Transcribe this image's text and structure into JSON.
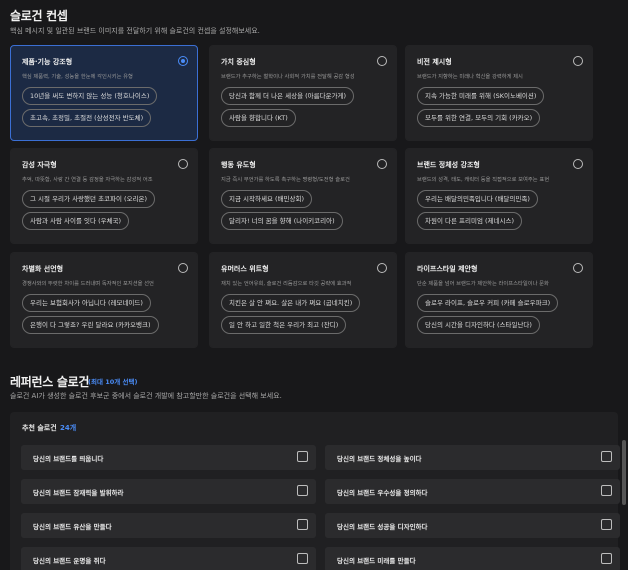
{
  "header": {
    "title": "슬로건 컨셉",
    "description": "핵심 메시지 및 일관된 브랜드 이미지를 전달하기 위해 슬로건의 컨셉을 설정해보세요."
  },
  "concepts": [
    {
      "title": "제품·기능 강조형",
      "desc": "핵심 제품력, 기술, 성능을 한눈에 각인시키는 유형",
      "selected": true,
      "examples": [
        "10년을 써도 변하지 않는 성능 (청호나이스)",
        "초고속, 초정밀, 초절전 (삼성전자 반도체)"
      ]
    },
    {
      "title": "가치 중심형",
      "desc": "브랜드가 추구하는 철학이나 사회적 가치를 전달해 공감 형성",
      "selected": false,
      "examples": [
        "당신과 함께 더 나은 세상을 (아름다운가게)",
        "사람을 향합니다 (KT)"
      ]
    },
    {
      "title": "비전 제시형",
      "desc": "브랜드가 지향하는 미래나 혁신을 강력하게 제시",
      "selected": false,
      "examples": [
        "지속 가능한 미래를 위해 (SK이노베이션)",
        "모두를 위한 연결, 모두의 기회 (카카오)"
      ]
    },
    {
      "title": "감성 자극형",
      "desc": "추억, 따뜻함, 사랑 간 연결 등 감정을 자극하는 감성적 어조",
      "selected": false,
      "examples": [
        "그 시절 우리가 사랑했던 초코파이 (오리온)",
        "사람과 사람 사이를 잇다 (우체국)"
      ]
    },
    {
      "title": "행동 유도형",
      "desc": "지금 즉시 무언가를 하도록 촉구하는 명령형/도전형 슬로건",
      "selected": false,
      "examples": [
        "지금 시작하세요 (배민상회)",
        "달리자! 너의 꿈을 향해 (나이키코리아)"
      ]
    },
    {
      "title": "브랜드 정체성 강조형",
      "desc": "브랜드의 성격, 태도, 캐릭터 등을 직접적으로 보여주는 표현",
      "selected": false,
      "examples": [
        "우리는 배달의민족입니다 (배달의민족)",
        "차원이 다른 프리미엄 (제네시스)"
      ]
    },
    {
      "title": "차별화 선언형",
      "desc": "경쟁사와의 뚜렷한 차이를 드러내며 독자적인 포지션을 선언",
      "selected": false,
      "examples": [
        "우리는 보험회사가 아닙니다 (레모네이드)",
        "은행이 다 그렇죠? 우린 달라요 (카카오뱅크)"
      ]
    },
    {
      "title": "유머러스 위트형",
      "desc": "재치 있는 언어유희, 슬로건 리듬감으로 타깃 공략에 효과적",
      "selected": false,
      "examples": [
        "치킨은 살 안 쪄요. 살은 내가 쪄요 (굽네치킨)",
        "일 안 하고 일한 척은 우리가 최고 (잔디)"
      ]
    },
    {
      "title": "라이프스타일 제안형",
      "desc": "단순 제품을 넘어 브랜드가 제안하는 라이프스타일이나 문화",
      "selected": false,
      "examples": [
        "슬로우 라이프, 슬로우 커피 (카페 슬로우파크)",
        "당신의 시간을 디자인하다 (스타일난다)"
      ]
    }
  ],
  "reference": {
    "title": "레퍼런스 슬로건",
    "badge": "(최대 10개 선택)",
    "description": "슬로건 AI가 생성한 슬로건 후보군 중에서 슬로건 개발에 참고할만한 슬로건을 선택해 보세요.",
    "recommend_label": "추천 슬로건",
    "recommend_count": "24개",
    "items": [
      "당신의 브랜드를 띄웁니다",
      "당신의 브랜드 정체성을 높이다",
      "당신의 브랜드 잠재력을 발휘하라",
      "당신의 브랜드 우수성을 정의하다",
      "당신의 브랜드 유산을 만들다",
      "당신의 브랜드 성공을 디자인하다",
      "당신의 브랜드 운명을 쥐다",
      "당신의 브랜드 미래를 만들다"
    ]
  },
  "colors": {
    "accent": "#4a8cf7",
    "selected_bg": "#1c2a44",
    "badge": "#4a8cf7"
  }
}
